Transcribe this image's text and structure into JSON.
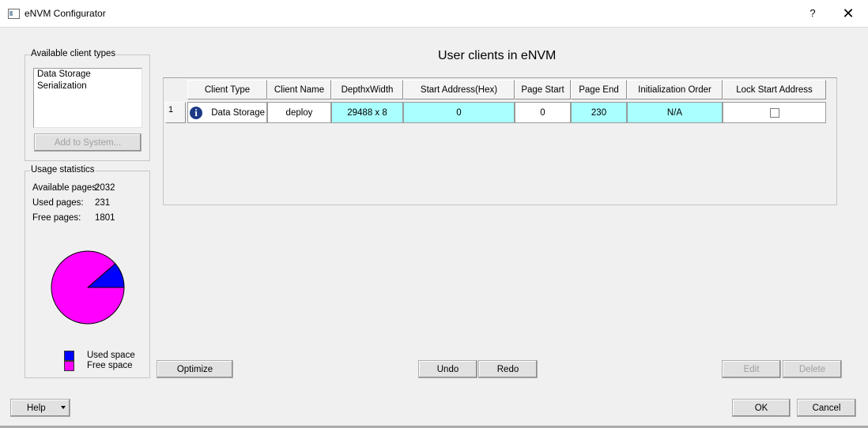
{
  "window": {
    "title": "eNVM Configurator",
    "help_glyph": "?",
    "close_glyph": "✕"
  },
  "client_types": {
    "label": "Available client types",
    "items": [
      "Data Storage",
      "Serialization"
    ],
    "add_button": "Add to System..."
  },
  "usage": {
    "label": "Usage statistics",
    "available_label": "Available pages:",
    "available_value": "2032",
    "used_label": "Used pages:",
    "used_value": "231",
    "free_label": "Free pages:",
    "free_value": "1801",
    "legend_used": "Used space",
    "legend_free": "Free space",
    "used_color": "#0000ff",
    "free_color": "#ff00ff"
  },
  "chart_data": {
    "type": "pie",
    "slices": [
      {
        "name": "Used space",
        "value": 231,
        "color": "#0000ff"
      },
      {
        "name": "Free space",
        "value": 1801,
        "color": "#ff00ff"
      }
    ]
  },
  "main": {
    "heading": "User clients in eNVM",
    "columns": [
      "Client Type",
      "Client Name",
      "DepthxWidth",
      "Start Address(Hex)",
      "Page Start",
      "Page End",
      "Initialization Order",
      "Lock Start Address"
    ],
    "rows": [
      {
        "num": "1",
        "icon": "info-icon",
        "cells": [
          "Data Storage",
          "deploy",
          "29488 x 8",
          "0",
          "0",
          "230",
          "N/A"
        ],
        "lock_checked": false
      }
    ]
  },
  "buttons": {
    "optimize": "Optimize",
    "undo": "Undo",
    "redo": "Redo",
    "edit": "Edit",
    "delete": "Delete",
    "help": "Help",
    "ok": "OK",
    "cancel": "Cancel"
  }
}
